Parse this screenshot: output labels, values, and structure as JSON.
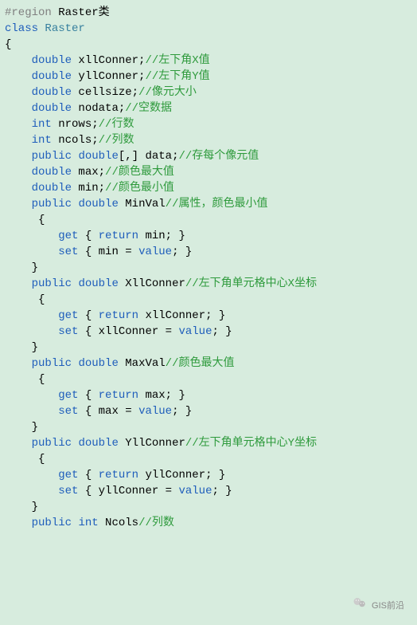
{
  "lines": [
    {
      "indent": 0,
      "segs": [
        {
          "t": "pp",
          "v": "#region"
        },
        {
          "t": "txt",
          "v": " Raster类"
        }
      ]
    },
    {
      "indent": 0,
      "segs": [
        {
          "t": "kw",
          "v": "class"
        },
        {
          "t": "txt",
          "v": " "
        },
        {
          "t": "type",
          "v": "Raster"
        }
      ]
    },
    {
      "indent": 0,
      "segs": [
        {
          "t": "txt",
          "v": "{"
        }
      ]
    },
    {
      "indent": 1,
      "segs": [
        {
          "t": "kw",
          "v": "double"
        },
        {
          "t": "txt",
          "v": " xllConner;"
        },
        {
          "t": "cm",
          "v": "//左下角X值"
        }
      ]
    },
    {
      "indent": 1,
      "segs": [
        {
          "t": "kw",
          "v": "double"
        },
        {
          "t": "txt",
          "v": " yllConner;"
        },
        {
          "t": "cm",
          "v": "//左下角Y值"
        }
      ]
    },
    {
      "indent": 1,
      "segs": [
        {
          "t": "kw",
          "v": "double"
        },
        {
          "t": "txt",
          "v": " cellsize;"
        },
        {
          "t": "cm",
          "v": "//像元大小"
        }
      ]
    },
    {
      "indent": 1,
      "segs": [
        {
          "t": "kw",
          "v": "double"
        },
        {
          "t": "txt",
          "v": " nodata;"
        },
        {
          "t": "cm",
          "v": "//空数据"
        }
      ]
    },
    {
      "indent": 1,
      "segs": [
        {
          "t": "kw",
          "v": "int"
        },
        {
          "t": "txt",
          "v": " nrows;"
        },
        {
          "t": "cm",
          "v": "//行数"
        }
      ]
    },
    {
      "indent": 1,
      "segs": [
        {
          "t": "kw",
          "v": "int"
        },
        {
          "t": "txt",
          "v": " ncols;"
        },
        {
          "t": "cm",
          "v": "//列数"
        }
      ]
    },
    {
      "indent": 1,
      "segs": [
        {
          "t": "kw",
          "v": "public"
        },
        {
          "t": "txt",
          "v": " "
        },
        {
          "t": "kw",
          "v": "double"
        },
        {
          "t": "txt",
          "v": "[,] data;"
        },
        {
          "t": "cm",
          "v": "//存每个像元值"
        }
      ]
    },
    {
      "indent": 1,
      "segs": [
        {
          "t": "kw",
          "v": "double"
        },
        {
          "t": "txt",
          "v": " max;"
        },
        {
          "t": "cm",
          "v": "//颜色最大值"
        }
      ]
    },
    {
      "indent": 1,
      "segs": [
        {
          "t": "kw",
          "v": "double"
        },
        {
          "t": "txt",
          "v": " min;"
        },
        {
          "t": "cm",
          "v": "//颜色最小值"
        }
      ]
    },
    {
      "indent": 1,
      "segs": [
        {
          "t": "kw",
          "v": "public"
        },
        {
          "t": "txt",
          "v": " "
        },
        {
          "t": "kw",
          "v": "double"
        },
        {
          "t": "txt",
          "v": " MinVal"
        },
        {
          "t": "cm",
          "v": "//属性，颜色最小值"
        }
      ]
    },
    {
      "indent": 1,
      "segs": [
        {
          "t": "txt",
          "v": " {"
        }
      ]
    },
    {
      "indent": 2,
      "segs": [
        {
          "t": "kw",
          "v": "get"
        },
        {
          "t": "txt",
          "v": " { "
        },
        {
          "t": "kw",
          "v": "return"
        },
        {
          "t": "txt",
          "v": " min; }"
        }
      ]
    },
    {
      "indent": 2,
      "segs": [
        {
          "t": "kw",
          "v": "set"
        },
        {
          "t": "txt",
          "v": " { min = "
        },
        {
          "t": "kw",
          "v": "value"
        },
        {
          "t": "txt",
          "v": "; }"
        }
      ]
    },
    {
      "indent": 1,
      "segs": [
        {
          "t": "txt",
          "v": "}"
        }
      ]
    },
    {
      "indent": 1,
      "segs": [
        {
          "t": "kw",
          "v": "public"
        },
        {
          "t": "txt",
          "v": " "
        },
        {
          "t": "kw",
          "v": "double"
        },
        {
          "t": "txt",
          "v": " XllConner"
        },
        {
          "t": "cm",
          "v": "//左下角单元格中心X坐标"
        }
      ]
    },
    {
      "indent": 1,
      "segs": [
        {
          "t": "txt",
          "v": " {"
        }
      ]
    },
    {
      "indent": 2,
      "segs": [
        {
          "t": "kw",
          "v": "get"
        },
        {
          "t": "txt",
          "v": " { "
        },
        {
          "t": "kw",
          "v": "return"
        },
        {
          "t": "txt",
          "v": " xllConner; }"
        }
      ]
    },
    {
      "indent": 2,
      "segs": [
        {
          "t": "kw",
          "v": "set"
        },
        {
          "t": "txt",
          "v": " { xllConner = "
        },
        {
          "t": "kw",
          "v": "value"
        },
        {
          "t": "txt",
          "v": "; }"
        }
      ]
    },
    {
      "indent": 1,
      "segs": [
        {
          "t": "txt",
          "v": "}"
        }
      ]
    },
    {
      "indent": 1,
      "segs": [
        {
          "t": "kw",
          "v": "public"
        },
        {
          "t": "txt",
          "v": " "
        },
        {
          "t": "kw",
          "v": "double"
        },
        {
          "t": "txt",
          "v": " MaxVal"
        },
        {
          "t": "cm",
          "v": "//颜色最大值"
        }
      ]
    },
    {
      "indent": 1,
      "segs": [
        {
          "t": "txt",
          "v": " {"
        }
      ]
    },
    {
      "indent": 2,
      "segs": [
        {
          "t": "kw",
          "v": "get"
        },
        {
          "t": "txt",
          "v": " { "
        },
        {
          "t": "kw",
          "v": "return"
        },
        {
          "t": "txt",
          "v": " max; }"
        }
      ]
    },
    {
      "indent": 2,
      "segs": [
        {
          "t": "kw",
          "v": "set"
        },
        {
          "t": "txt",
          "v": " { max = "
        },
        {
          "t": "kw",
          "v": "value"
        },
        {
          "t": "txt",
          "v": "; }"
        }
      ]
    },
    {
      "indent": 1,
      "segs": [
        {
          "t": "txt",
          "v": "}"
        }
      ]
    },
    {
      "indent": 1,
      "segs": [
        {
          "t": "kw",
          "v": "public"
        },
        {
          "t": "txt",
          "v": " "
        },
        {
          "t": "kw",
          "v": "double"
        },
        {
          "t": "txt",
          "v": " YllConner"
        },
        {
          "t": "cm",
          "v": "//左下角单元格中心Y坐标"
        }
      ]
    },
    {
      "indent": 1,
      "segs": [
        {
          "t": "txt",
          "v": " {"
        }
      ]
    },
    {
      "indent": 2,
      "segs": [
        {
          "t": "kw",
          "v": "get"
        },
        {
          "t": "txt",
          "v": " { "
        },
        {
          "t": "kw",
          "v": "return"
        },
        {
          "t": "txt",
          "v": " yllConner; }"
        }
      ]
    },
    {
      "indent": 2,
      "segs": [
        {
          "t": "kw",
          "v": "set"
        },
        {
          "t": "txt",
          "v": " { yllConner = "
        },
        {
          "t": "kw",
          "v": "value"
        },
        {
          "t": "txt",
          "v": "; }"
        }
      ]
    },
    {
      "indent": 1,
      "segs": [
        {
          "t": "txt",
          "v": "}"
        }
      ]
    },
    {
      "indent": 1,
      "segs": [
        {
          "t": "kw",
          "v": "public"
        },
        {
          "t": "txt",
          "v": " "
        },
        {
          "t": "kw",
          "v": "int"
        },
        {
          "t": "txt",
          "v": " Ncols"
        },
        {
          "t": "cm",
          "v": "//列数"
        }
      ]
    }
  ],
  "footer": {
    "label": "GIS前沿"
  }
}
